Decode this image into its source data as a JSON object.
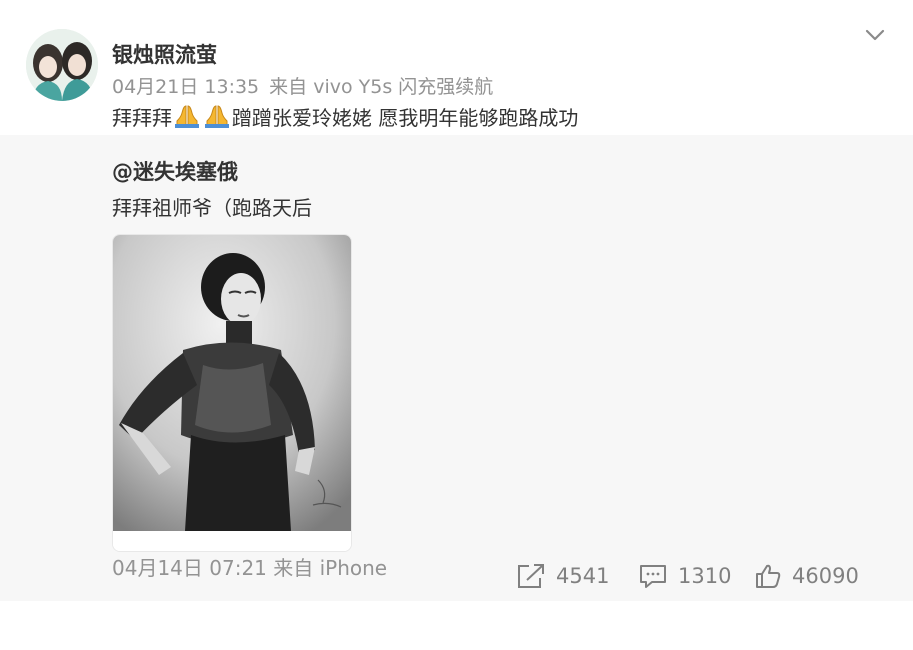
{
  "post": {
    "username": "银烛照流萤",
    "date": "04月21日 13:35",
    "source": "来自 vivo Y5s 闪充强续航",
    "text_before_emoji": "拜拜拜",
    "emoji_icon": "folded-hands-emoji",
    "text_after_emoji": "蹭蹭张爱玲姥姥 愿我明年能够跑路成功"
  },
  "repost": {
    "original_user": "@迷失埃塞俄",
    "original_text": "拜拜祖师爷（跑路天后",
    "original_meta": "04月14日 07:21 来自 iPhone",
    "actions": {
      "share_count": "4541",
      "comment_count": "1310",
      "like_count": "46090"
    }
  },
  "colors": {
    "text_primary": "#333333",
    "text_meta": "#939393",
    "repost_background": "#f7f7f7",
    "action_gray": "#808080"
  }
}
